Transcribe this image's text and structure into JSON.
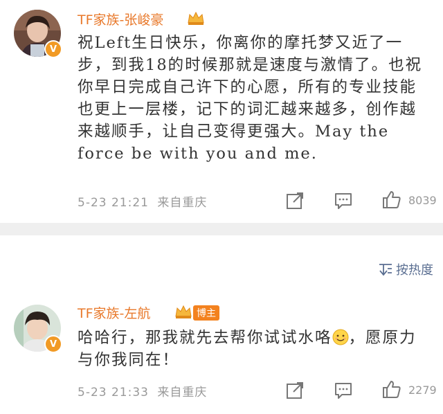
{
  "comments": [
    {
      "username": "TF家族-张峻豪",
      "content": "祝Left生日快乐，你离你的摩托梦又近了一步，到我18的时候那就是速度与激情了。也祝你早日完成自己许下的心愿，所有的专业技能也更上一层楼，记下的词汇越来越多，创作越来越顺手，让自己变得更强大。May the force be with you and me.",
      "time": "5-23 21:21",
      "location": "来自重庆",
      "like_count": "8039"
    },
    {
      "username": "TF家族-左航",
      "badge": "博主",
      "content_before_emoji": "哈哈行，那我就先去帮你试试水咯",
      "content_after_emoji": "，愿原力与你我同在！",
      "time": "5-23 21:33",
      "location": "来自重庆",
      "like_count": "2279"
    }
  ],
  "sort": {
    "label": "按热度"
  },
  "colors": {
    "username": "#e8782a",
    "badge": "#f3821f",
    "meta": "#999999",
    "sort": "#5b6f92",
    "divider": "#efefef"
  }
}
